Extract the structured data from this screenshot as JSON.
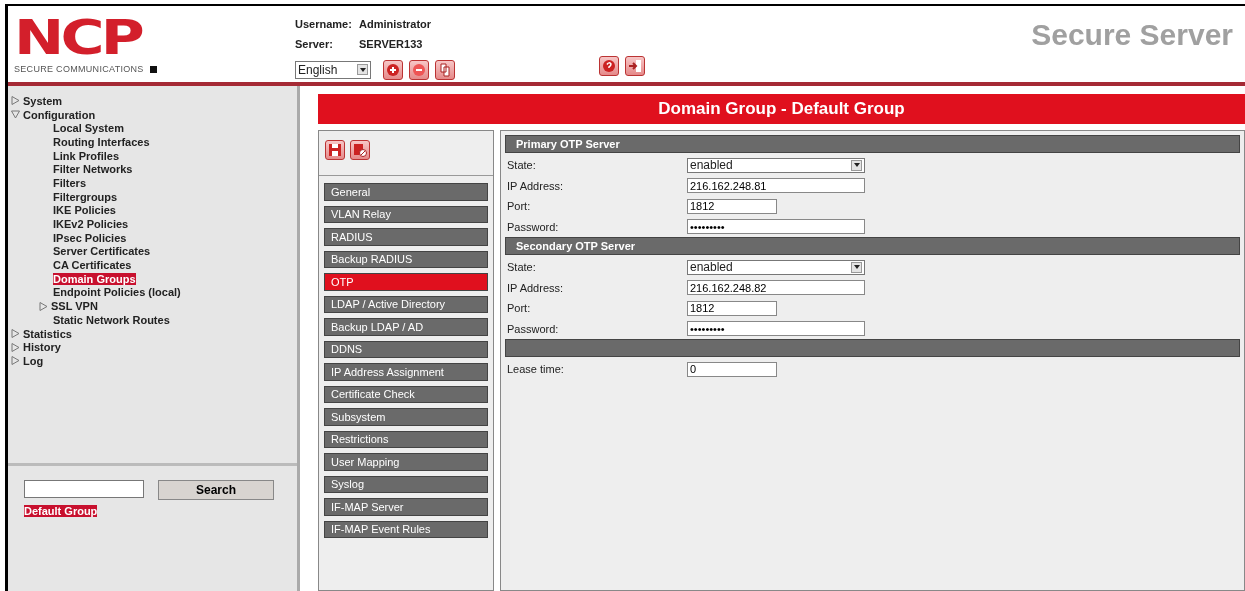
{
  "logo": {
    "mark": "NCP",
    "tagline": "SECURE COMMUNICATIONS"
  },
  "session": {
    "username_label": "Username:",
    "username": "Administrator",
    "server_label": "Server:",
    "server": "SERVER133",
    "language": "English"
  },
  "product": "Secure Server",
  "tree": [
    {
      "label": "System",
      "expanded": false,
      "selected": false
    },
    {
      "label": "Configuration",
      "expanded": true,
      "selected": false,
      "children": [
        {
          "label": "Local System",
          "selected": false
        },
        {
          "label": "Routing Interfaces",
          "selected": false
        },
        {
          "label": "Link Profiles",
          "selected": false
        },
        {
          "label": "Filter Networks",
          "selected": false
        },
        {
          "label": "Filters",
          "selected": false
        },
        {
          "label": "Filtergroups",
          "selected": false
        },
        {
          "label": "IKE Policies",
          "selected": false
        },
        {
          "label": "IKEv2 Policies",
          "selected": false
        },
        {
          "label": "IPsec Policies",
          "selected": false
        },
        {
          "label": "Server Certificates",
          "selected": false
        },
        {
          "label": "CA Certificates",
          "selected": false
        },
        {
          "label": "Domain Groups",
          "selected": true
        },
        {
          "label": "Endpoint Policies (local)",
          "selected": false
        },
        {
          "label": "SSL VPN",
          "expanded": false,
          "selected": false
        },
        {
          "label": "Static Network Routes",
          "selected": false
        }
      ]
    },
    {
      "label": "Statistics",
      "expanded": false,
      "selected": false
    },
    {
      "label": "History",
      "expanded": false,
      "selected": false
    },
    {
      "label": "Log",
      "expanded": false,
      "selected": false
    }
  ],
  "search": {
    "button": "Search",
    "results": [
      {
        "label": "Default Group",
        "selected": true
      }
    ]
  },
  "page_title": "Domain Group - Default Group",
  "sections": [
    {
      "label": "General",
      "selected": false
    },
    {
      "label": "VLAN Relay",
      "selected": false
    },
    {
      "label": "RADIUS",
      "selected": false
    },
    {
      "label": "Backup RADIUS",
      "selected": false
    },
    {
      "label": "OTP",
      "selected": true
    },
    {
      "label": "LDAP / Active Directory",
      "selected": false
    },
    {
      "label": "Backup LDAP / AD",
      "selected": false
    },
    {
      "label": "DDNS",
      "selected": false
    },
    {
      "label": "IP Address Assignment",
      "selected": false
    },
    {
      "label": "Certificate Check",
      "selected": false
    },
    {
      "label": "Subsystem",
      "selected": false
    },
    {
      "label": "Restrictions",
      "selected": false
    },
    {
      "label": "User Mapping",
      "selected": false
    },
    {
      "label": "Syslog",
      "selected": false
    },
    {
      "label": "IF-MAP Server",
      "selected": false
    },
    {
      "label": "IF-MAP Event Rules",
      "selected": false
    }
  ],
  "groups": [
    {
      "title": "Primary OTP Server",
      "fields": [
        {
          "kind": "select",
          "label": "State:",
          "value": "enabled"
        },
        {
          "kind": "wide",
          "label": "IP Address:",
          "value": "216.162.248.81"
        },
        {
          "kind": "short",
          "label": "Port:",
          "value": "1812"
        },
        {
          "kind": "wide",
          "label": "Password:",
          "value": "•••••••••"
        }
      ]
    },
    {
      "title": "Secondary OTP Server",
      "fields": [
        {
          "kind": "select",
          "label": "State:",
          "value": "enabled"
        },
        {
          "kind": "wide",
          "label": "IP Address:",
          "value": "216.162.248.82"
        },
        {
          "kind": "short",
          "label": "Port:",
          "value": "1812"
        },
        {
          "kind": "wide",
          "label": "Password:",
          "value": "•••••••••"
        }
      ]
    },
    {
      "fields": [
        {
          "kind": "short",
          "label": "Lease time:",
          "value": "0"
        }
      ]
    }
  ]
}
